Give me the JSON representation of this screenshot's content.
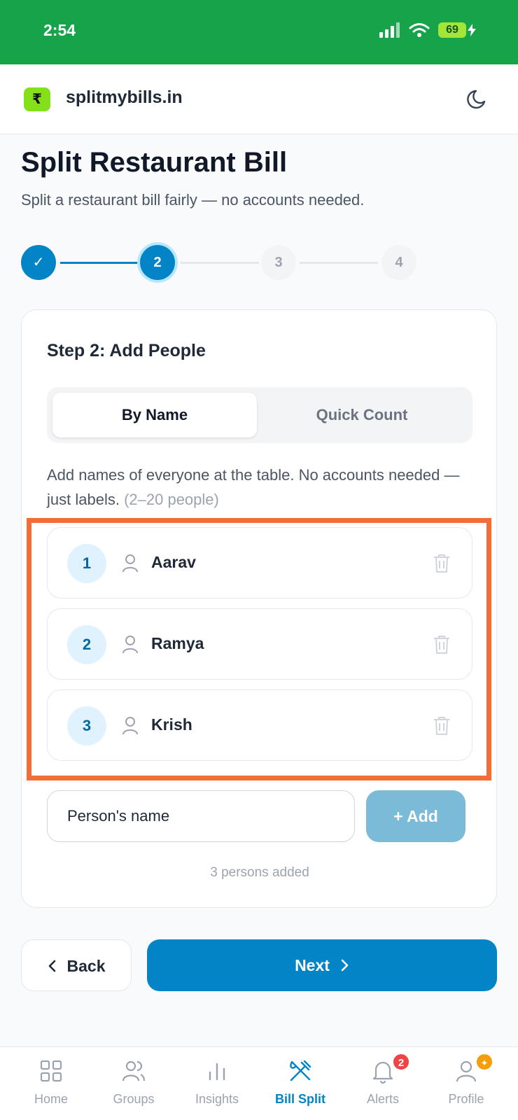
{
  "status": {
    "time": "2:54",
    "battery": "69"
  },
  "header": {
    "logo_symbol": "₹",
    "site": "splitmybills.in"
  },
  "page": {
    "title": "Split Restaurant Bill",
    "subtitle": "Split a restaurant bill fairly — no accounts needed."
  },
  "stepper": {
    "current": 2,
    "steps": [
      {
        "label": "✓",
        "state": "done"
      },
      {
        "label": "2",
        "state": "active"
      },
      {
        "label": "3",
        "state": "todo"
      },
      {
        "label": "4",
        "state": "todo"
      }
    ]
  },
  "card": {
    "title": "Step 2: Add People",
    "tabs": {
      "by_name": "By Name",
      "quick_count": "Quick Count",
      "selected": "By Name"
    },
    "help": "Add names of everyone at the table. No accounts needed — just labels.",
    "help_range": "(2–20 people)",
    "people": [
      {
        "num": "1",
        "name": "Aarav"
      },
      {
        "num": "2",
        "name": "Ramya"
      },
      {
        "num": "3",
        "name": "Krish"
      }
    ],
    "name_input": {
      "placeholder": "Person's name",
      "value": ""
    },
    "add_label": "+ Add",
    "count_text": "3 persons added"
  },
  "footer": {
    "back_label": "Back",
    "next_label": "Next"
  },
  "nav": {
    "items": [
      {
        "label": "Home",
        "icon": "grid-icon"
      },
      {
        "label": "Groups",
        "icon": "users-icon"
      },
      {
        "label": "Insights",
        "icon": "bar-chart-icon"
      },
      {
        "label": "Bill Split",
        "icon": "fork-knife-icon",
        "active": true
      },
      {
        "label": "Alerts",
        "icon": "bell-icon",
        "badge": "2"
      },
      {
        "label": "Profile",
        "icon": "user-icon",
        "badge": "✦"
      }
    ]
  },
  "colors": {
    "brand": "#0284c7",
    "status_bar": "#16a34a",
    "highlight": "#f26d38",
    "logo": "#84e01b"
  }
}
